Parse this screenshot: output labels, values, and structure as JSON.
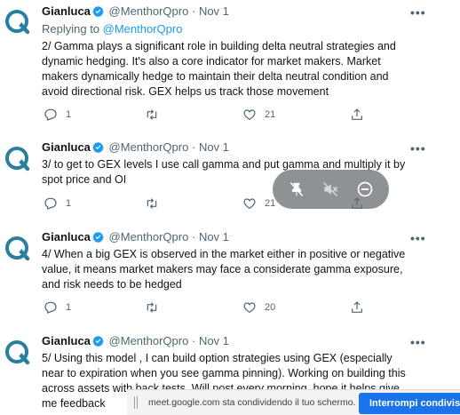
{
  "colors": {
    "accent": "#1d9bf0",
    "text": "#0f1419",
    "muted": "#536471",
    "share_button": "#1a73e8"
  },
  "tweets": [
    {
      "name": "Gianluca",
      "handle": "@MenthorQpro",
      "dot": "·",
      "time": "Nov 1",
      "reply_prefix": "Replying to ",
      "reply_to": "@MenthorQpro",
      "text": "2/ Gamma plays a significant role in building delta neutral strategies and dynamic hedging. It's also a core indicator for market makers. Market makers dynamically hedge to maintain their delta neutral condition and avoid directional risk. GEX helps us track those movement",
      "replies": "1",
      "retweets": "",
      "likes": "21"
    },
    {
      "name": "Gianluca",
      "handle": "@MenthorQpro",
      "dot": "·",
      "time": "Nov 1",
      "text": "3/ to get to GEX levels I use call gamma and put gamma and multiply it by spot price and OI",
      "replies": "1",
      "retweets": "",
      "likes": "21"
    },
    {
      "name": "Gianluca",
      "handle": "@MenthorQpro",
      "dot": "·",
      "time": "Nov 1",
      "text": "4/ When a big GEX is observed in the market either in positive or negative value, it means market makers may face a considerate gamma exposure, and risk needs to be hedged",
      "replies": "1",
      "retweets": "",
      "likes": "20"
    },
    {
      "name": "Gianluca",
      "handle": "@MenthorQpro",
      "dot": "·",
      "time": "Nov 1",
      "text": "5/ Using this model , I can build option strategies using GEX (especially near to expiration when you see gamma pinning). Working on building this across assets with back tests. Will post every morning, hope it helps give me feedback"
    }
  ],
  "more_label": "•••",
  "floating_controls": {
    "icons": [
      "pin-off-icon",
      "mute-icon",
      "remove-icon"
    ]
  },
  "share_bar": {
    "message": "meet.google.com sta condividendo il tuo schermo.",
    "stop_label": "Interrompi condivisione"
  }
}
